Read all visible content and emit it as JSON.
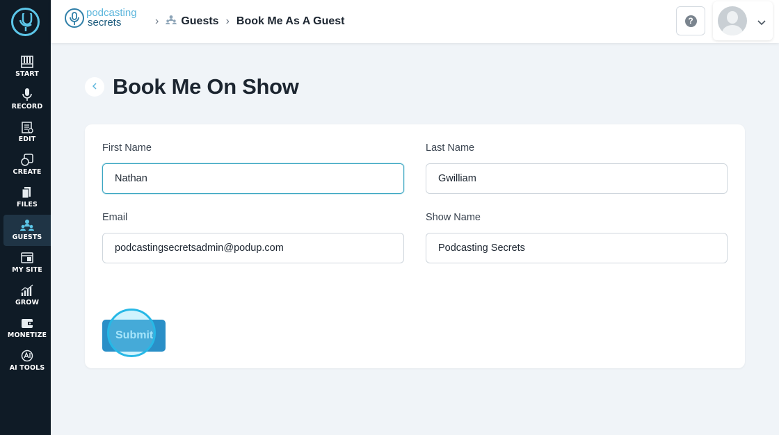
{
  "sidebar": {
    "items": [
      {
        "label": "START",
        "icon": "piano-icon"
      },
      {
        "label": "RECORD",
        "icon": "microphone-icon"
      },
      {
        "label": "EDIT",
        "icon": "edit-icon"
      },
      {
        "label": "CREATE",
        "icon": "create-icon"
      },
      {
        "label": "FILES",
        "icon": "files-icon"
      },
      {
        "label": "GUESTS",
        "icon": "guests-icon",
        "active": true
      },
      {
        "label": "MY SITE",
        "icon": "website-icon"
      },
      {
        "label": "GROW",
        "icon": "chart-icon"
      },
      {
        "label": "MONETIZE",
        "icon": "wallet-icon"
      },
      {
        "label": "AI TOOLS",
        "icon": "ai-icon"
      }
    ]
  },
  "header": {
    "brand_line1": "podcasting",
    "brand_line2": "secrets",
    "breadcrumb": {
      "section": "Guests",
      "page": "Book Me As A Guest"
    },
    "help_label": "?"
  },
  "page": {
    "title": "Book Me On Show"
  },
  "form": {
    "first_name": {
      "label": "First Name",
      "value": "Nathan"
    },
    "last_name": {
      "label": "Last Name",
      "value": "Gwilliam"
    },
    "email": {
      "label": "Email",
      "value": "podcastingsecretsadmin@podup.com"
    },
    "show_name": {
      "label": "Show Name",
      "value": "Podcasting Secrets"
    },
    "submit_label": "Submit"
  },
  "colors": {
    "sidebar_bg": "#0f1b26",
    "accent": "#2a8fc7",
    "focus_border": "#3aa6c2"
  }
}
